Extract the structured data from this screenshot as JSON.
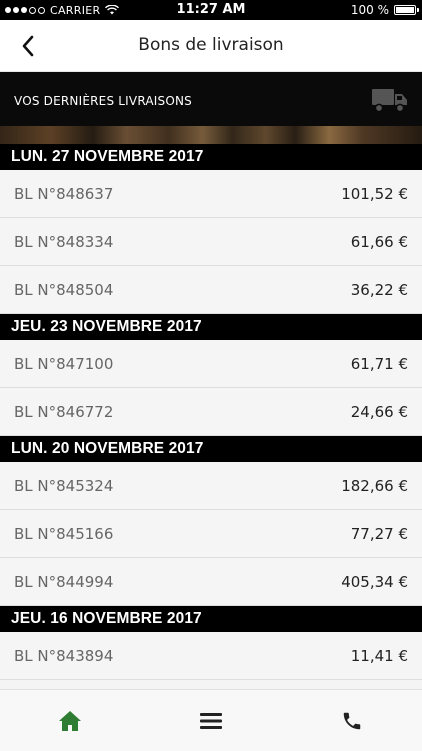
{
  "status_bar": {
    "carrier": "CARRIER",
    "time": "11:27 AM",
    "battery": "100 %"
  },
  "nav": {
    "title": "Bons de livraison",
    "back_icon": "chevron-left-icon"
  },
  "banner": {
    "text": "VOS DERNIÈRES LIVRAISONS",
    "icon": "truck-icon"
  },
  "sections": [
    {
      "date": "LUN. 27 NOVEMBRE 2017",
      "rows": [
        {
          "label": "BL N°848637",
          "amount": "101,52 €"
        },
        {
          "label": "BL N°848334",
          "amount": "61,66 €"
        },
        {
          "label": "BL N°848504",
          "amount": "36,22 €"
        }
      ]
    },
    {
      "date": "JEU. 23 NOVEMBRE 2017",
      "rows": [
        {
          "label": "BL N°847100",
          "amount": "61,71 €"
        },
        {
          "label": "BL N°846772",
          "amount": "24,66 €"
        }
      ]
    },
    {
      "date": "LUN. 20 NOVEMBRE 2017",
      "rows": [
        {
          "label": "BL N°845324",
          "amount": "182,66 €"
        },
        {
          "label": "BL N°845166",
          "amount": "77,27 €"
        },
        {
          "label": "BL N°844994",
          "amount": "405,34 €"
        }
      ]
    },
    {
      "date": "JEU. 16 NOVEMBRE 2017",
      "rows": [
        {
          "label": "BL N°843894",
          "amount": "11,41 €"
        }
      ]
    }
  ],
  "tab_bar": {
    "items": [
      {
        "icon": "home-icon",
        "color": "#2e7d32"
      },
      {
        "icon": "menu-icon",
        "color": "#222222"
      },
      {
        "icon": "phone-icon",
        "color": "#222222"
      }
    ]
  }
}
